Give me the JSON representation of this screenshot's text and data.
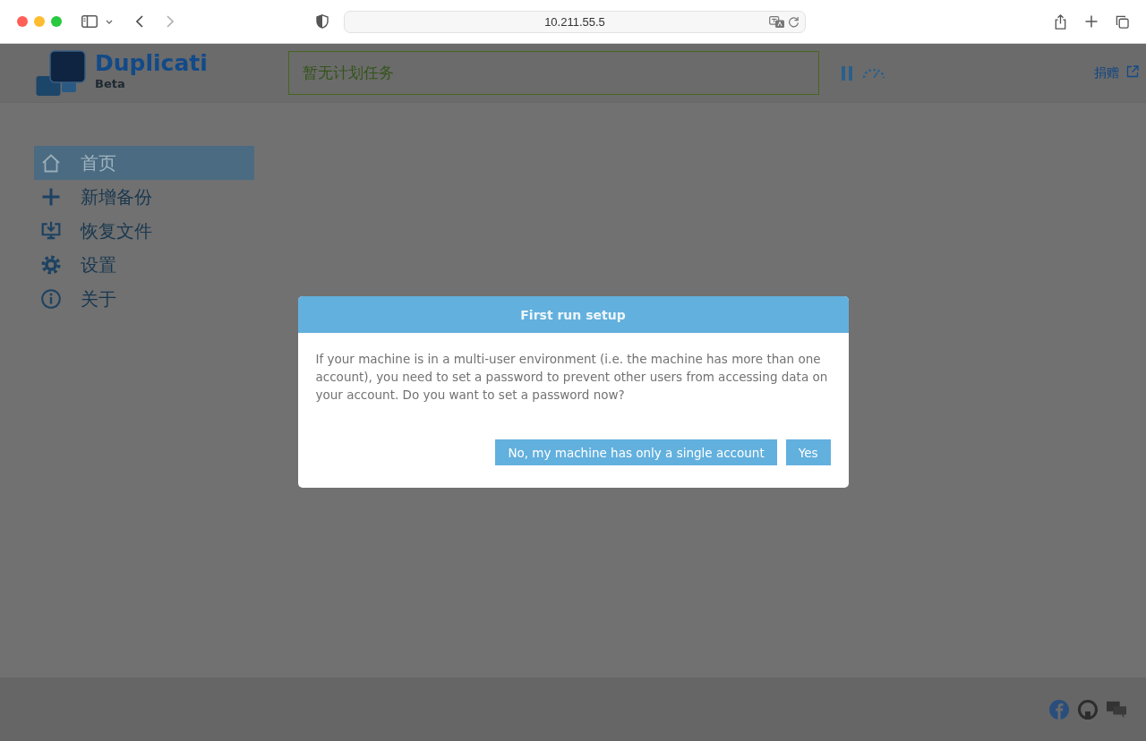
{
  "browser": {
    "url": "10.211.55.5"
  },
  "header": {
    "logo": {
      "name": "Duplicati",
      "edition": "Beta"
    },
    "status": "暂无计划任务",
    "donate_link": "捐赠"
  },
  "sidebar": {
    "items": [
      {
        "label": "首页",
        "selected": true
      },
      {
        "label": "新增备份",
        "selected": false
      },
      {
        "label": "恢复文件",
        "selected": false
      },
      {
        "label": "设置",
        "selected": false
      },
      {
        "label": "关于",
        "selected": false
      }
    ]
  },
  "dialog": {
    "title": "First run setup",
    "message": "If your machine is in a multi-user environment (i.e. the machine has more than one account), you need to set a password to prevent other users from accessing data on your account. Do you want to set a password now?",
    "buttons": [
      {
        "label": "No, my machine has only a single account"
      },
      {
        "label": "Yes"
      }
    ]
  }
}
